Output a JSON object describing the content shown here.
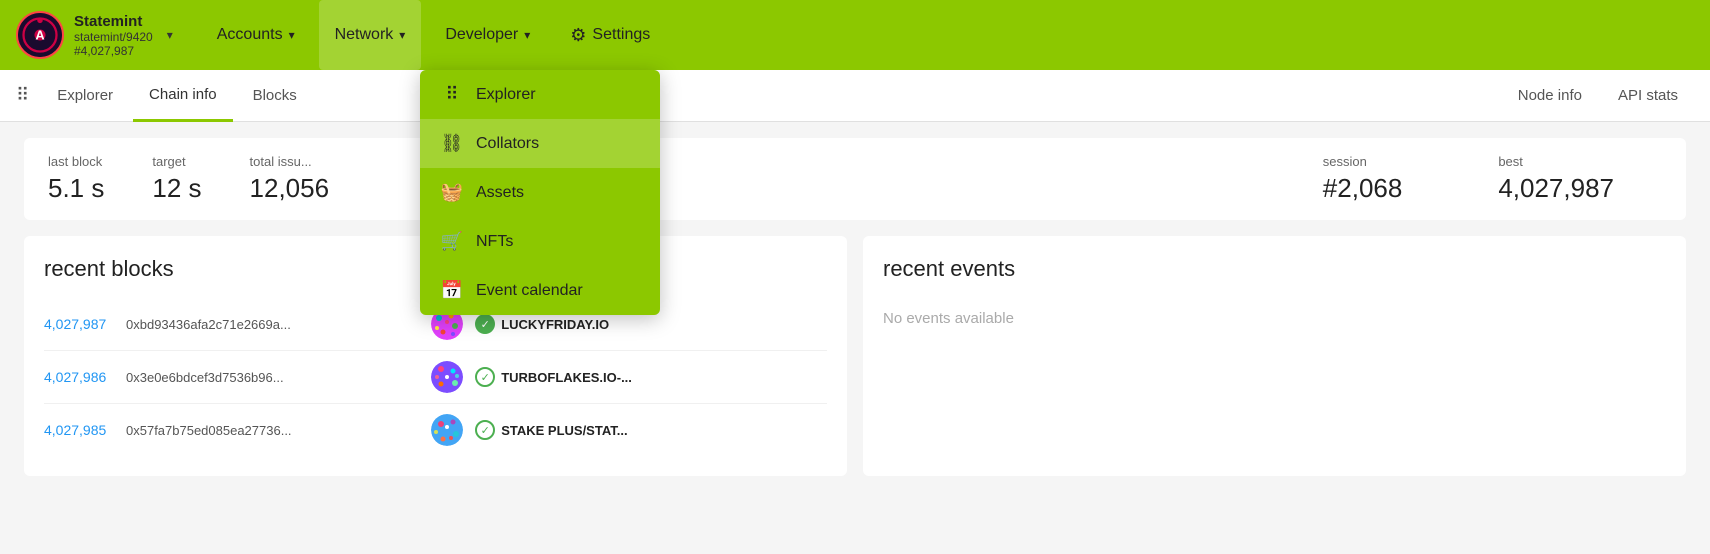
{
  "brand": {
    "name": "Statemint",
    "subtitle_line1": "statemint/9420",
    "subtitle_line2": "#4,027,987",
    "avatar_letter": "A"
  },
  "top_nav": {
    "accounts_label": "Accounts",
    "network_label": "Network",
    "developer_label": "Developer",
    "settings_label": "Settings"
  },
  "sub_nav": {
    "explorer_label": "Explorer",
    "chain_info_label": "Chain info",
    "blocks_label": "B...",
    "node_info_label": "Node info",
    "api_stats_label": "API stats"
  },
  "stats": {
    "last_block_label": "last block",
    "last_block_value": "5.1 s",
    "target_label": "target",
    "target_value": "12 s",
    "total_issuance_label": "total issu...",
    "total_issuance_value": "12,056",
    "session_label": "session",
    "session_value": "#2,068",
    "best_label": "best",
    "best_value": "4,027,987"
  },
  "recent_blocks": {
    "title": "recent blocks",
    "blocks": [
      {
        "number": "4,027,987",
        "hash": "0xbd93436afa2c71e2669a...",
        "name": "LUCKYFRIDAY.IO",
        "status": "check"
      },
      {
        "number": "4,027,986",
        "hash": "0x3e0e6bdcef3d7536b96...",
        "name": "TURBOFLAKES.IO-...",
        "status": "check-outline"
      },
      {
        "number": "4,027,985",
        "hash": "0x57fa7b75ed085ea27736...",
        "name": "STAKE PLUS/STAT...",
        "status": "check-outline"
      }
    ]
  },
  "recent_events": {
    "title": "recent events",
    "empty_message": "No events available"
  },
  "network_dropdown": {
    "items": [
      {
        "label": "Explorer",
        "icon": "grid"
      },
      {
        "label": "Collators",
        "icon": "nodes"
      },
      {
        "label": "Assets",
        "icon": "basket"
      },
      {
        "label": "NFTs",
        "icon": "cart"
      },
      {
        "label": "Event calendar",
        "icon": "calendar"
      }
    ]
  }
}
